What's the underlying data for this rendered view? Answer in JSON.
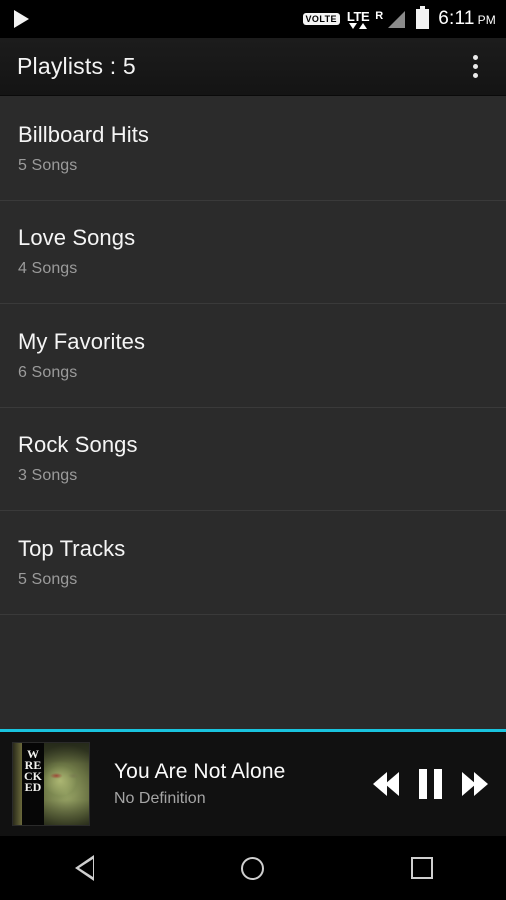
{
  "statusbar": {
    "notification_icon": "play-icon",
    "volte_label": "VOLTE",
    "network_label": "LTE",
    "roaming_label": "R",
    "signal_icon": "signal-bars-icon",
    "battery_icon": "battery-full-icon",
    "time": "6:11",
    "ampm": "PM"
  },
  "actionbar": {
    "title": "Playlists : 5",
    "overflow_icon": "overflow-menu-icon"
  },
  "playlists": [
    {
      "name": "Billboard Hits",
      "count": "5 Songs"
    },
    {
      "name": "Love Songs",
      "count": "4 Songs"
    },
    {
      "name": "My Favorites",
      "count": "6 Songs"
    },
    {
      "name": "Rock Songs",
      "count": "3 Songs"
    },
    {
      "name": "Top Tracks",
      "count": "5 Songs"
    }
  ],
  "player": {
    "album_art_text": "WRECKED",
    "track_title": "You Are Not Alone",
    "artist": "No Definition",
    "previous_icon": "rewind-icon",
    "playpause_icon": "pause-icon",
    "next_icon": "fast-forward-icon",
    "accent_color": "#19c4de"
  },
  "navbar": {
    "back_icon": "back-triangle-icon",
    "home_icon": "home-circle-icon",
    "recents_icon": "recents-square-icon"
  }
}
